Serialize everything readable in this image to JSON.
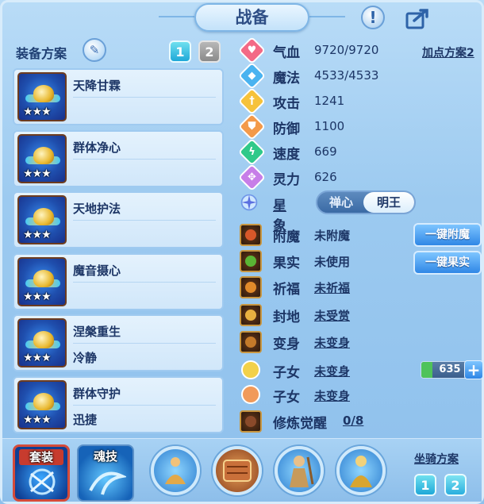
{
  "title": "战备",
  "left": {
    "plan_label": "装备方案",
    "plan_buttons": [
      "1",
      "2"
    ],
    "equipment": [
      {
        "name": "天降甘霖",
        "sub": "",
        "stars": "★★★"
      },
      {
        "name": "群体净心",
        "sub": "",
        "stars": "★★★"
      },
      {
        "name": "天地护法",
        "sub": "",
        "stars": "★★★"
      },
      {
        "name": "魔音摄心",
        "sub": "",
        "stars": "★★★"
      },
      {
        "name": "涅槃重生",
        "sub": "冷静",
        "stars": "★★★"
      },
      {
        "name": "群体守护",
        "sub": "迅捷",
        "stars": "★★★"
      }
    ]
  },
  "right": {
    "plus_plan": "加点方案2",
    "stats": [
      {
        "label": "气血",
        "value": "9720/9720",
        "color": "#f36a86",
        "glyph": "♥"
      },
      {
        "label": "魔法",
        "value": "4533/4533",
        "color": "#4ab3f0",
        "glyph": "◆"
      },
      {
        "label": "攻击",
        "value": "1241",
        "color": "#f6c23a",
        "glyph": "†"
      },
      {
        "label": "防御",
        "value": "1100",
        "color": "#f39a4a",
        "glyph": "⛊"
      },
      {
        "label": "速度",
        "value": "669",
        "color": "#2fc98a",
        "glyph": "ϟ"
      },
      {
        "label": "灵力",
        "value": "626",
        "color": "#c77ee8",
        "glyph": "✥"
      }
    ],
    "constellation": {
      "label": "星象",
      "options": [
        "禅心",
        "明王"
      ],
      "selected": "明王"
    },
    "attributes": [
      {
        "label": "附魔",
        "value": "未附魔",
        "underline": false
      },
      {
        "label": "果实",
        "value": "未使用",
        "underline": false
      },
      {
        "label": "祈福",
        "value": "未祈福",
        "underline": true
      },
      {
        "label": "封地",
        "value": "未受赏",
        "underline": true
      },
      {
        "label": "变身",
        "value": "未变身",
        "underline": true
      },
      {
        "label": "子女",
        "value": "未变身",
        "underline": true
      },
      {
        "label": "子女",
        "value": "未变身",
        "underline": true
      },
      {
        "label": "修炼觉醒",
        "value": "0/8",
        "underline": true
      }
    ],
    "buttons": {
      "enchant": "一键附魔",
      "fruit": "一键果实"
    },
    "counter": {
      "value": "635",
      "plus": "+"
    }
  },
  "bottom": {
    "suit_label": "套装",
    "soul_label": "魂技",
    "mount_label": "坐骑方案",
    "mount_buttons": [
      "1",
      "2"
    ]
  },
  "header": {
    "info": "!"
  }
}
